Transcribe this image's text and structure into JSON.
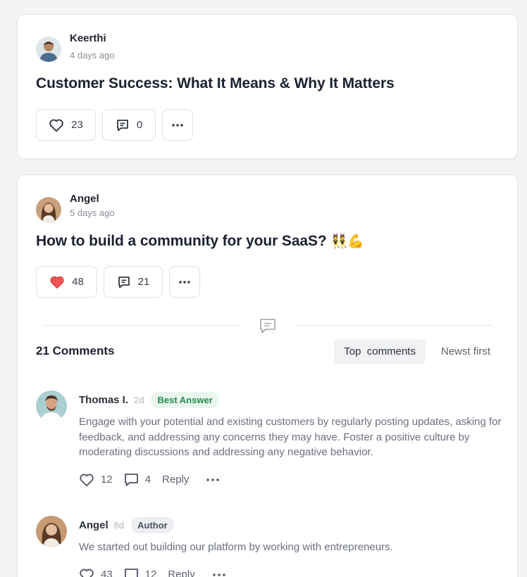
{
  "posts": [
    {
      "author": "Keerthi",
      "time": "4 days ago",
      "title": "Customer Success: What It Means & Why It Matters",
      "title_emoji": "",
      "likes": "23",
      "comments": "0",
      "liked": false
    },
    {
      "author": "Angel",
      "time": "5 days ago",
      "title": "How to build a community for your SaaS?",
      "title_emoji": "👯💪",
      "likes": "48",
      "comments": "21",
      "liked": true
    }
  ],
  "comments_section": {
    "count_label": "21 Comments",
    "sort_options": [
      "Top  comments",
      "Newst first"
    ],
    "active_sort": "Top  comments"
  },
  "comments": [
    {
      "name": "Thomas I.",
      "age": "2d",
      "badge": "Best Answer",
      "text": "Engage with your potential and existing customers by regularly posting updates, asking for feedback, and addressing any concerns they may have. Foster a positive culture by moderating discussions and addressing any negative behavior.",
      "likes": "12",
      "replies": "4",
      "reply_label": "Reply"
    },
    {
      "name": "Angel",
      "age": "8d",
      "badge": "Author",
      "text": "We started out building our platform by working with entrepreneurs.",
      "likes": "43",
      "replies": "12",
      "reply_label": "Reply"
    }
  ],
  "colors": {
    "liked_heart": "#f05454",
    "best_answer": "#238a4e",
    "background": "#f3f4f6"
  },
  "icons": [
    "heart-icon",
    "comment-icon",
    "more-icon",
    "chat-divider-icon"
  ]
}
